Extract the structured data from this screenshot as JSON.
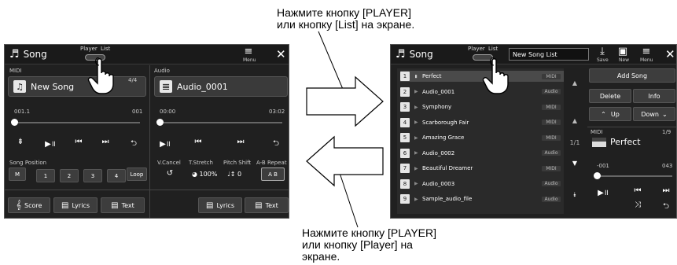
{
  "captions": {
    "top": [
      "Нажмите кнопку [PLAYER]",
      "или кнопку [List] на экране."
    ],
    "bottom": [
      "Нажмите кнопку [PLAYER]",
      "или кнопку [Player] на",
      "экране."
    ]
  },
  "player_screen": {
    "title": "Song",
    "tab_player": "Player",
    "tab_list": "List",
    "menu_label": "Menu",
    "midi": {
      "label": "MIDI",
      "song": "New Song",
      "page": "4/4",
      "pos_start": "001.1",
      "pos_end": "001",
      "position_fraction": 0.0
    },
    "audio": {
      "label": "Audio",
      "song": "Audio_0001",
      "time_start": "00:00",
      "time_end": "03:02",
      "position_fraction": 0.0
    },
    "song_position": {
      "label": "Song Position",
      "buttons": [
        "M",
        "1",
        "2",
        "3",
        "4",
        "Loop"
      ]
    },
    "audio_effects": {
      "vcancel": "V.Cancel",
      "tstretch": "T.Stretch",
      "tstretch_value": "100%",
      "pitch_shift": "Pitch Shift",
      "pitch_value": "0",
      "ab_repeat": "A-B Repeat",
      "ab_value": "A B"
    },
    "bottom_buttons": {
      "score": "Score",
      "lyrics_midi": "Lyrics",
      "text_midi": "Text",
      "lyrics_audio": "Lyrics",
      "text_audio": "Text"
    }
  },
  "list_screen": {
    "title": "Song",
    "tab_player": "Player",
    "tab_list": "List",
    "list_name": "New Song List",
    "toolbar": {
      "save": "Save",
      "new": "New",
      "menu": "Menu"
    },
    "page": "1/1",
    "songs": [
      {
        "num": "1",
        "name": "Perfect",
        "type": "MIDI",
        "playing": true
      },
      {
        "num": "2",
        "name": "Audio_0001",
        "type": "Audio",
        "playing": false
      },
      {
        "num": "3",
        "name": "Symphony",
        "type": "MIDI",
        "playing": false
      },
      {
        "num": "4",
        "name": "Scarborough Fair",
        "type": "MIDI",
        "playing": false
      },
      {
        "num": "5",
        "name": "Amazing Grace",
        "type": "MIDI",
        "playing": false
      },
      {
        "num": "6",
        "name": "Audio_0002",
        "type": "Audio",
        "playing": false
      },
      {
        "num": "7",
        "name": "Beautiful Dreamer",
        "type": "MIDI",
        "playing": false
      },
      {
        "num": "8",
        "name": "Audio_0003",
        "type": "Audio",
        "playing": false
      },
      {
        "num": "9",
        "name": "Sample_audio_file",
        "type": "Audio",
        "playing": false
      }
    ],
    "side": {
      "add_song": "Add Song",
      "delete": "Delete",
      "info": "Info",
      "up": "Up",
      "down": "Down",
      "midi_label": "MIDI",
      "midi_page": "1/9",
      "current_song": "Perfect",
      "pos_start": "-001",
      "pos_end": "043",
      "position_fraction": 0.0
    }
  }
}
